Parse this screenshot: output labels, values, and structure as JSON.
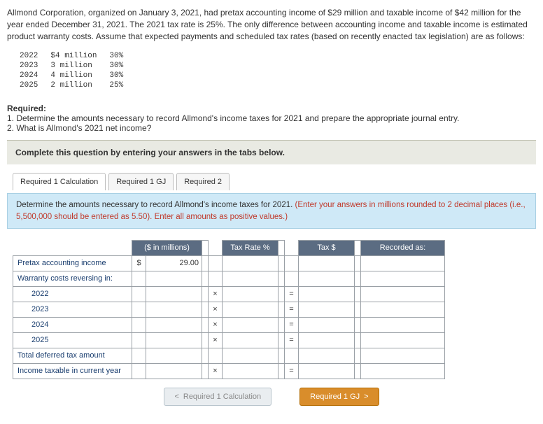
{
  "intro": "Allmond Corporation, organized on January 3, 2021, had pretax accounting income of $29 million and taxable income of $42 million for the year ended December 31, 2021. The 2021 tax rate is 25%. The only difference between accounting income and taxable income is estimated product warranty costs. Assume that expected payments and scheduled tax rates (based on recently enacted tax legislation) are as follows:",
  "rate_rows": [
    {
      "year": "2022",
      "amt": "$4 million",
      "rate": "30%"
    },
    {
      "year": "2023",
      "amt": "3 million",
      "rate": "30%"
    },
    {
      "year": "2024",
      "amt": "4 million",
      "rate": "30%"
    },
    {
      "year": "2025",
      "amt": "2 million",
      "rate": "25%"
    }
  ],
  "required": {
    "title": "Required:",
    "items": [
      "1. Determine the amounts necessary to record Allmond's income taxes for 2021 and prepare the appropriate journal entry.",
      "2. What is Allmond's 2021 net income?"
    ]
  },
  "complete_msg": "Complete this question by entering your answers in the tabs below.",
  "tabs": [
    {
      "label": "Required 1 Calculation"
    },
    {
      "label": "Required 1 GJ"
    },
    {
      "label": "Required 2"
    }
  ],
  "instruct_main": "Determine the amounts necessary to record Allmond's income taxes for 2021. ",
  "instruct_red": "(Enter your answers in millions rounded to 2 decimal places (i.e., 5,500,000 should be entered as 5.50). Enter all amounts as positive values.)",
  "headers": {
    "amt": "($ in millions)",
    "rate": "Tax Rate %",
    "tax": "Tax $",
    "rec": "Recorded as:"
  },
  "rows": {
    "pretax": {
      "lbl": "Pretax accounting income",
      "val": "29.00"
    },
    "rev": {
      "lbl": "Warranty costs reversing in:"
    },
    "y2022": {
      "lbl": "2022"
    },
    "y2023": {
      "lbl": "2023"
    },
    "y2024": {
      "lbl": "2024"
    },
    "y2025": {
      "lbl": "2025"
    },
    "tot": {
      "lbl": "Total deferred tax amount"
    },
    "taxcy": {
      "lbl": "Income taxable in current year"
    }
  },
  "sym": {
    "times": "×",
    "eq": "="
  },
  "nav": {
    "prev_btn": "Required 1 Calculation",
    "next_btn": "Required 1 GJ",
    "lt": "<",
    "gt": ">"
  }
}
